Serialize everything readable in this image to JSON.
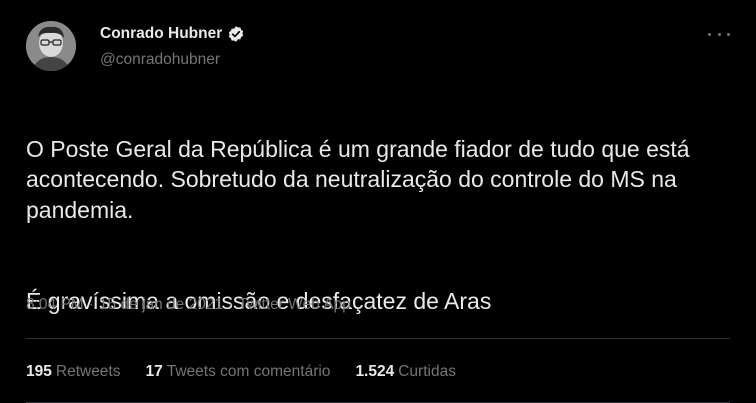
{
  "author": {
    "display_name": "Conrado Hubner",
    "handle": "@conradohubner",
    "verified": true
  },
  "tweet": {
    "paragraphs": [
      "O Poste Geral da República é um grande fiador de tudo que está acontecendo. Sobretudo da neutralização do controle do MS na pandemia.",
      "É gravíssima a omissão e desfaçatez de Aras"
    ],
    "time": "8:04 PM",
    "separator": "·",
    "date": "15 de jan de 2021",
    "source": "Twitter Web App"
  },
  "stats": {
    "retweets_count": "195",
    "retweets_label": "Retweets",
    "quotes_count": "17",
    "quotes_label": "Tweets com comentário",
    "likes_count": "1.524",
    "likes_label": "Curtidas"
  },
  "colors": {
    "background": "#000000",
    "text": "#e7e9ea",
    "secondary": "#71767b",
    "divider": "#2f3336"
  },
  "icons": [
    "verified-badge-icon",
    "more-options-icon"
  ]
}
